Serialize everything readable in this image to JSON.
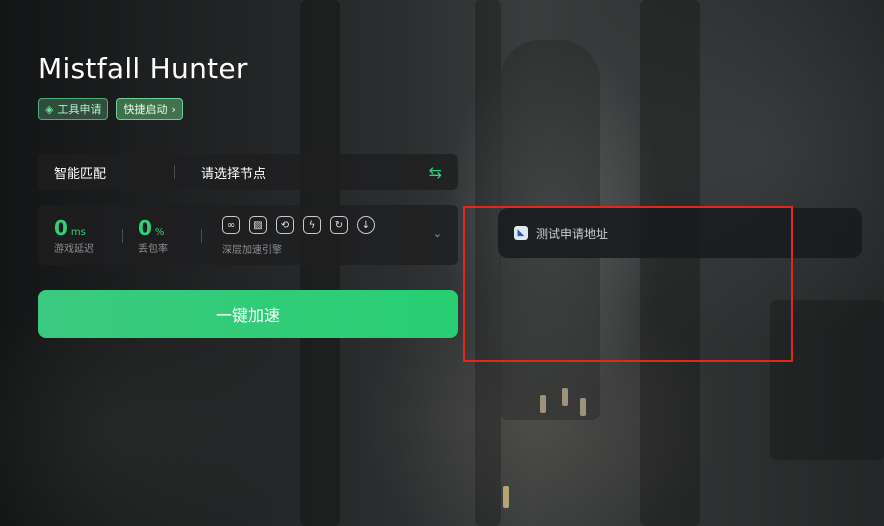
{
  "game": {
    "title": "Mistfall Hunter"
  },
  "tags": [
    {
      "label": "工具申请",
      "icon": "cube-icon"
    },
    {
      "label": "快捷启动",
      "icon": "chevron-right-icon",
      "suffix": "›"
    }
  ],
  "node": {
    "mode": "智能匹配",
    "select_placeholder": "请选择节点",
    "swap_icon": "⇆"
  },
  "stats": {
    "latency": {
      "value": "0",
      "unit": "ms",
      "label": "游戏延迟"
    },
    "loss": {
      "value": "0",
      "unit": "%",
      "label": "丢包率"
    },
    "engine_label": "深层加速引擎",
    "engine_icons": [
      "link-icon",
      "image-icon",
      "refresh-icon",
      "lightning-icon",
      "rotate-icon",
      "download-icon"
    ],
    "expand_icon": "⌄"
  },
  "boost_button": {
    "label": "一键加速"
  },
  "test_panel": {
    "label": "测试申请地址",
    "icon": "app-icon"
  },
  "colors": {
    "accent": "#2fd27a",
    "highlight": "#e2281d"
  }
}
